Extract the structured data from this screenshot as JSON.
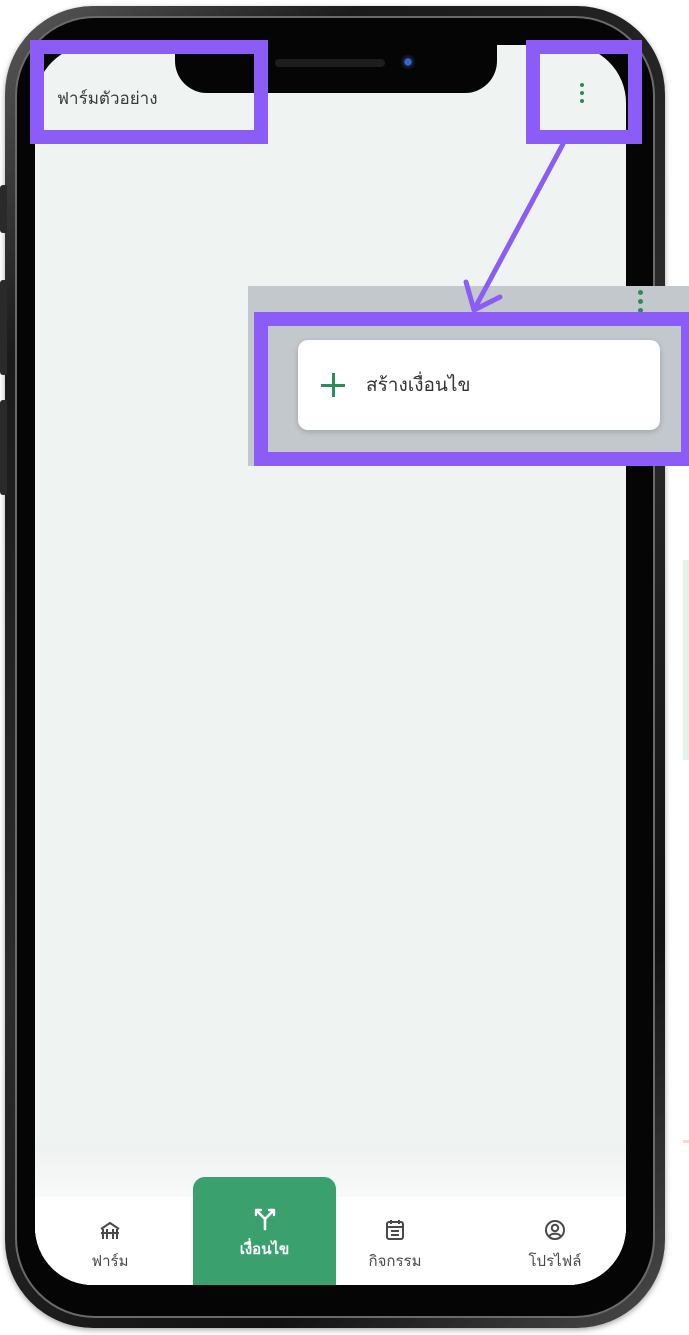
{
  "app": {
    "title": "ฟาร์มตัวอย่าง"
  },
  "menu": {
    "items": [
      {
        "label": "สร้างเงื่อนไข",
        "icon": "plus-icon"
      }
    ]
  },
  "bottom_nav": {
    "active": "เงื่อนไข",
    "items": [
      {
        "label": "ฟาร์ม",
        "icon": "farm-icon"
      },
      {
        "label": "เงื่อนไข",
        "icon": "branch-icon"
      },
      {
        "label": "กิจกรรม",
        "icon": "calendar-icon"
      },
      {
        "label": "โปรไฟล์",
        "icon": "profile-icon"
      }
    ]
  },
  "colors": {
    "accent_green": "#3aa06e",
    "highlight_purple": "#8b5cf6",
    "screen_background": "#eff4f3"
  }
}
